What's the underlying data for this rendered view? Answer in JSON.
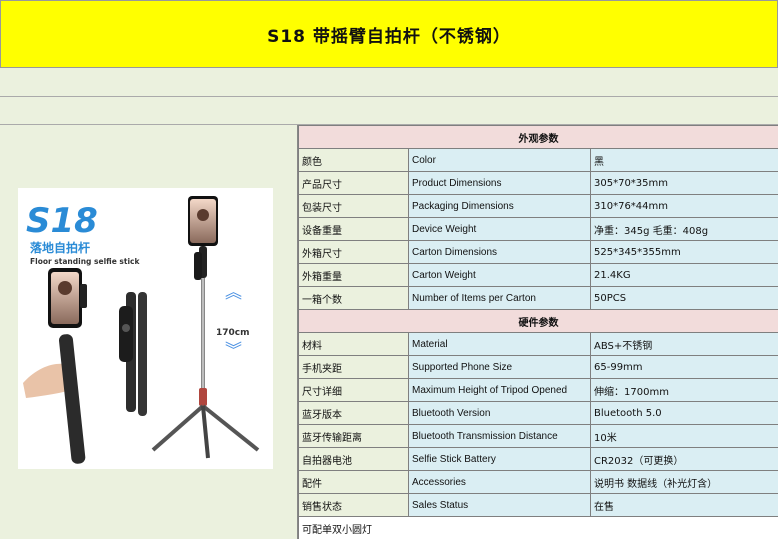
{
  "title": "S18 带摇臂自拍杆（不锈钢）",
  "image": {
    "brand_model": "S18",
    "title_cn": "落地自拍杆",
    "title_en": "Floor standing selfie stick",
    "height_label": "170cm"
  },
  "sections": [
    {
      "header": "外观参数",
      "rows": [
        {
          "cn": "颜色",
          "en": "Color",
          "value": "黑"
        },
        {
          "cn": "产品尺寸",
          "en": "Product Dimensions",
          "value": "305*70*35mm"
        },
        {
          "cn": "包装尺寸",
          "en": "Packaging Dimensions",
          "value": "310*76*44mm"
        },
        {
          "cn": "设备重量",
          "en": "Device Weight",
          "value": "净重：345g 毛重：408g"
        },
        {
          "cn": "外箱尺寸",
          "en": "Carton Dimensions",
          "value": "525*345*355mm"
        },
        {
          "cn": "外箱重量",
          "en": "Carton Weight",
          "value": "21.4KG"
        },
        {
          "cn": "一箱个数",
          "en": "Number of Items per Carton",
          "value": "50PCS"
        }
      ]
    },
    {
      "header": "硬件参数",
      "rows": [
        {
          "cn": "材料",
          "en": "Material",
          "value": "ABS+不锈钢"
        },
        {
          "cn": "手机夹距",
          "en": "Supported Phone Size",
          "value": "65-99mm"
        },
        {
          "cn": "尺寸详细",
          "en": "Maximum Height of Tripod Opened",
          "value": "伸缩：1700mm"
        },
        {
          "cn": "蓝牙版本",
          "en": "Bluetooth Version",
          "value": "Bluetooth 5.0"
        },
        {
          "cn": "蓝牙传输距离",
          "en": "Bluetooth Transmission Distance",
          "value": "10米"
        },
        {
          "cn": "自拍器电池",
          "en": "Selfie Stick Battery",
          "value": "CR2032（可更换）"
        },
        {
          "cn": "配件",
          "en": "Accessories",
          "value": "说明书 数据线（补光灯含）"
        },
        {
          "cn": "销售状态",
          "en": "Sales Status",
          "value": "在售"
        }
      ]
    }
  ],
  "note": "可配单双小圆灯",
  "colors": {
    "title_bg": "#ffff00",
    "section_header_bg": "#f2dcdb",
    "label_bg": "#ebf1de",
    "value_bg": "#daeef3",
    "note_color": "#e00000"
  }
}
